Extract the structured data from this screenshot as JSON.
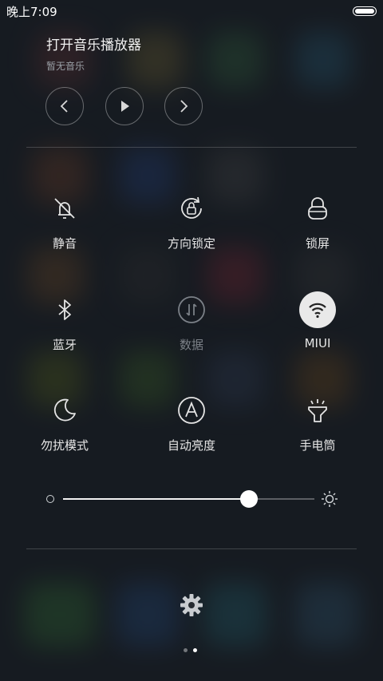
{
  "status_bar": {
    "time": "晚上7:09"
  },
  "music": {
    "title": "打开音乐播放器",
    "subtitle": "暂无音乐"
  },
  "toggles": [
    {
      "label": "静音",
      "icon": "bell-off-icon"
    },
    {
      "label": "方向锁定",
      "icon": "rotation-lock-icon"
    },
    {
      "label": "锁屏",
      "icon": "padlock-icon"
    },
    {
      "label": "蓝牙",
      "icon": "bluetooth-icon"
    },
    {
      "label": "数据",
      "icon": "mobile-data-icon"
    },
    {
      "label": "MIUI",
      "icon": "wifi-icon"
    },
    {
      "label": "勿扰模式",
      "icon": "moon-icon"
    },
    {
      "label": "自动亮度",
      "icon": "auto-brightness-icon"
    },
    {
      "label": "手电筒",
      "icon": "flashlight-icon"
    }
  ],
  "brightness": {
    "level_fraction": 0.74
  },
  "pager": {
    "pages": 2,
    "current": 2
  },
  "colors": {
    "accent": "#ffffff",
    "active_toggle_bg": "#e9e9e9"
  }
}
